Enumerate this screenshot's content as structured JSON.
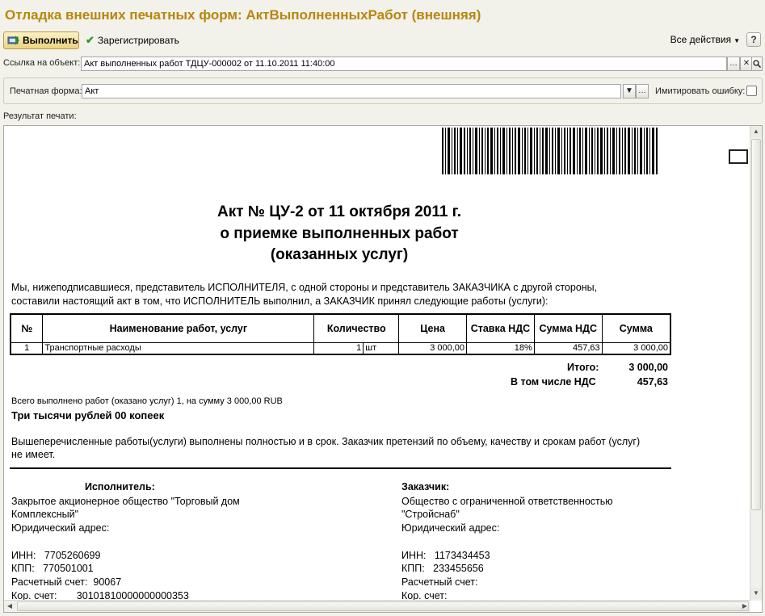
{
  "window": {
    "title": "Отладка внешних печатных форм: АктВыполненныхРабот (внешняя)"
  },
  "toolbar": {
    "execute_label": "Выполнить",
    "register_label": "Зарегистрировать",
    "all_actions_label": "Все действия",
    "help_label": "?"
  },
  "object_link": {
    "label": "Ссылка на объект:",
    "value": "Акт выполненных работ ТДЦУ-000002 от 11.10.2011 11:40:00"
  },
  "print_form": {
    "label": "Печатная форма:",
    "value": "Акт",
    "simulate_error_label": "Имитировать ошибку:",
    "simulate_error_checked": false
  },
  "result_label": "Результат печати:",
  "document": {
    "title_line1": "Акт № ЦУ-2 от 11 октября 2011 г.",
    "title_line2": "о приемке выполненных работ",
    "title_line3": "(оказанных услуг)",
    "intro_line1": " Мы, нижеподписавшиеся,  представитель ИСПОЛНИТЕЛЯ, с одной стороны и  представитель ЗАКАЗЧИКА с другой стороны,",
    "intro_line2": "составили настоящий акт в том, что ИСПОЛНИТЕЛЬ выполнил, а ЗАКАЗЧИК принял следующие работы (услуги):",
    "table": {
      "headers": [
        "№",
        "Наименование работ, услуг",
        "Количество",
        "Цена",
        "Ставка НДС",
        "Сумма НДС",
        "Сумма"
      ],
      "rows": [
        {
          "num": "1",
          "name": "Транспортные расходы",
          "qty": "1",
          "unit": "шт",
          "price": "3 000,00",
          "vat_rate": "18%",
          "vat_sum": "457,63",
          "sum": "3 000,00"
        }
      ]
    },
    "total_label": "Итого:",
    "total_value": "3 000,00",
    "vat_label": "В том числе НДС",
    "vat_value": "457,63",
    "summary_line": "Всего выполнено работ (оказано услуг) 1, на сумму 3 000,00 RUB",
    "amount_words": "Три тысячи рублей 00 копеек",
    "statement_line1": "Вышеперечисленные работы(услуги) выполнены полностью и в срок. Заказчик претензий по объему, качеству и срокам работ (услуг)",
    "statement_line2": "не имеет.",
    "executor": {
      "heading": "Исполнитель:",
      "name_line1": "Закрытое акционерное общество \"Торговый дом",
      "name_line2": "Комплексный\"",
      "address": "Юридический адрес:",
      "inn": "ИНН:   7705260699",
      "kpp": "КПП:   770501001",
      "account": "Расчетный счет:  90067",
      "corr": "Кор. счет:       30101810000000000353"
    },
    "customer": {
      "heading": "Заказчик:",
      "name_line1": "Общество с ограниченной ответственностью",
      "name_line2": "\"Стройснаб\"",
      "address": "Юридический адрес:",
      "inn": "ИНН:   1173434453",
      "kpp": "КПП:   233455656",
      "account": "Расчетный счет:",
      "corr": "Кор. счет:"
    }
  }
}
